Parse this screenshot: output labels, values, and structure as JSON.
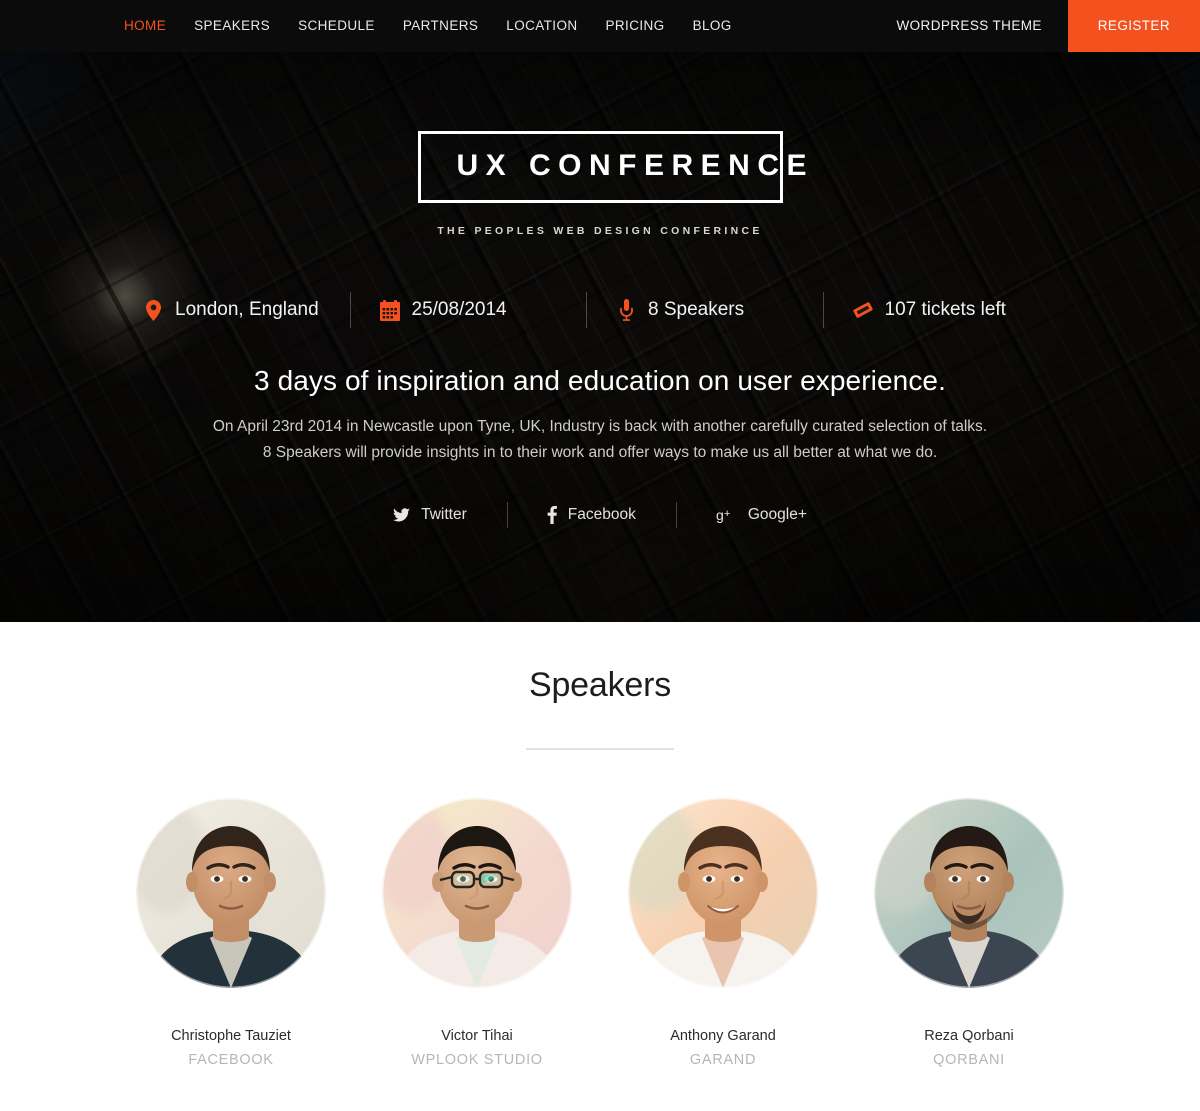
{
  "nav": {
    "items": [
      {
        "label": "HOME",
        "active": true
      },
      {
        "label": "SPEAKERS",
        "active": false
      },
      {
        "label": "SCHEDULE",
        "active": false
      },
      {
        "label": "PARTNERS",
        "active": false
      },
      {
        "label": "LOCATION",
        "active": false
      },
      {
        "label": "PRICING",
        "active": false
      },
      {
        "label": "BLOG",
        "active": false
      }
    ],
    "theme_link": "WORDPRESS THEME",
    "register_button": "REGISTER",
    "accent_color": "#f4511e",
    "bar_color": "#0b0b0c"
  },
  "hero": {
    "logo": "UX CONFERENCE",
    "tagline": "THE PEOPLES WEB DESIGN CONFERINCE",
    "info": [
      {
        "icon": "location-pin-icon",
        "text": "London, England"
      },
      {
        "icon": "calendar-icon",
        "text": "25/08/2014"
      },
      {
        "icon": "microphone-icon",
        "text": "8 Speakers"
      },
      {
        "icon": "ticket-icon",
        "text": "107 tickets left"
      }
    ],
    "headline": "3 days of inspiration and education on user experience.",
    "paragraph_line1": "On April 23rd 2014 in Newcastle upon Tyne, UK, Industry is back with another carefully curated selection of talks.",
    "paragraph_line2": "8 Speakers will provide insights in to their work and offer ways to make us all better at what we do.",
    "social": [
      {
        "icon": "twitter-icon",
        "glyph": "🐦",
        "label": "Twitter"
      },
      {
        "icon": "facebook-icon",
        "glyph": "f",
        "label": "Facebook"
      },
      {
        "icon": "google-plus-icon",
        "glyph": "g+",
        "label": "Google+"
      }
    ]
  },
  "speakers_section": {
    "title": "Speakers",
    "speakers": [
      {
        "name": "Christophe Tauziet",
        "role": "FACEBOOK",
        "avatar": "portrait-young-man-dark-jacket"
      },
      {
        "name": "Victor Tihai",
        "role": "WPLOOK STUDIO",
        "avatar": "portrait-man-glasses-white-shirt"
      },
      {
        "name": "Anthony Garand",
        "role": "GARAND",
        "avatar": "portrait-smiling-man-outdoors"
      },
      {
        "name": "Reza Qorbani",
        "role": "QORBANI",
        "avatar": "portrait-man-suit-tie"
      }
    ]
  }
}
